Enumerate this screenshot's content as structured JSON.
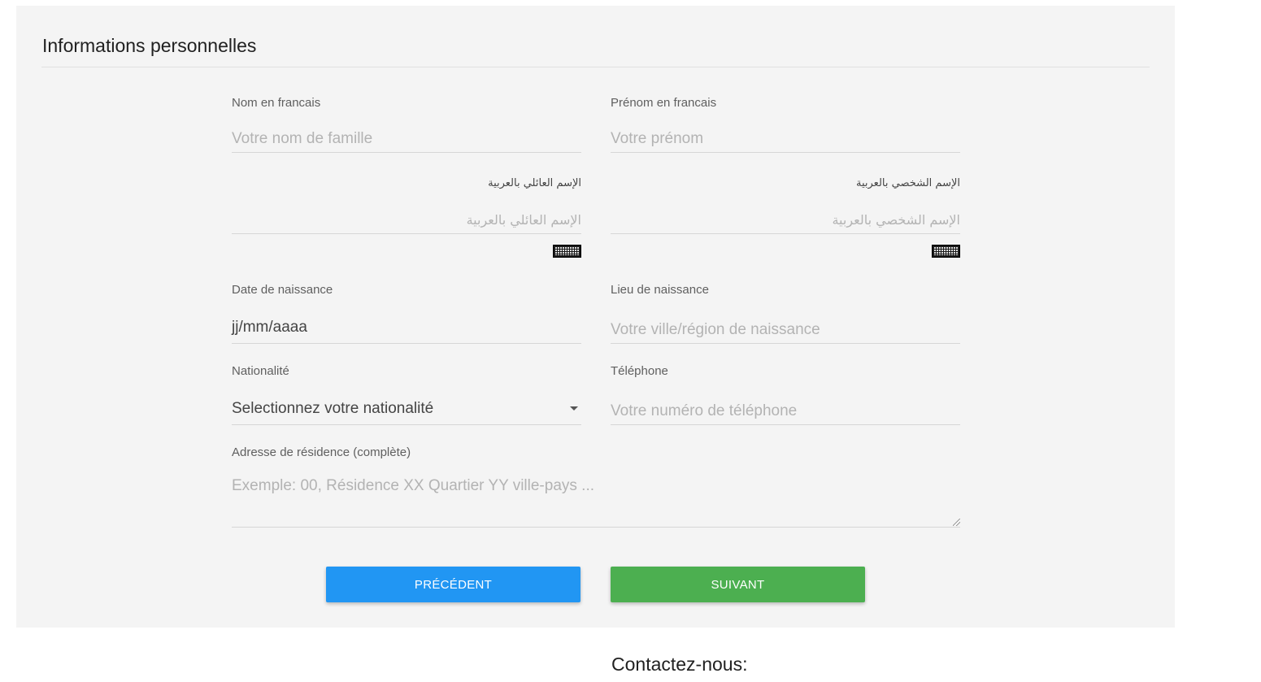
{
  "section_title": "Informations personnelles",
  "fields": {
    "nom_fr": {
      "label": "Nom en francais",
      "placeholder": "Votre nom de famille"
    },
    "prenom_fr": {
      "label": "Prénom en francais",
      "placeholder": "Votre prénom"
    },
    "nom_ar": {
      "label": "الإسم العائلي بالعربية",
      "placeholder": "الإسم العائلي بالعربية"
    },
    "prenom_ar": {
      "label": "الإسم الشخصي بالعربية",
      "placeholder": "الإسم الشخصي بالعربية"
    },
    "date_naissance": {
      "label": "Date de naissance",
      "value": "jj/mm/aaaa"
    },
    "lieu_naissance": {
      "label": "Lieu de naissance",
      "placeholder": "Votre ville/région de naissance"
    },
    "nationalite": {
      "label": "Nationalité",
      "selected": "Selectionnez votre nationalité"
    },
    "telephone": {
      "label": "Téléphone",
      "placeholder": "Votre numéro de téléphone"
    },
    "adresse": {
      "label": "Adresse de résidence (complète)",
      "placeholder": "Exemple: 00, Résidence XX Quartier YY ville-pays ..."
    }
  },
  "icons": {
    "keyboard": "keyboard-icon",
    "dropdown": "caret-down-icon",
    "resize": "resize-handle-icon"
  },
  "buttons": {
    "previous": "PRÉCÉDENT",
    "next": "SUIVANT"
  },
  "colors": {
    "panel_bg": "#f4f4f4",
    "previous_button": "#2196f3",
    "next_button": "#4caf50"
  },
  "footer": {
    "contact_heading": "Contactez-nous:"
  }
}
